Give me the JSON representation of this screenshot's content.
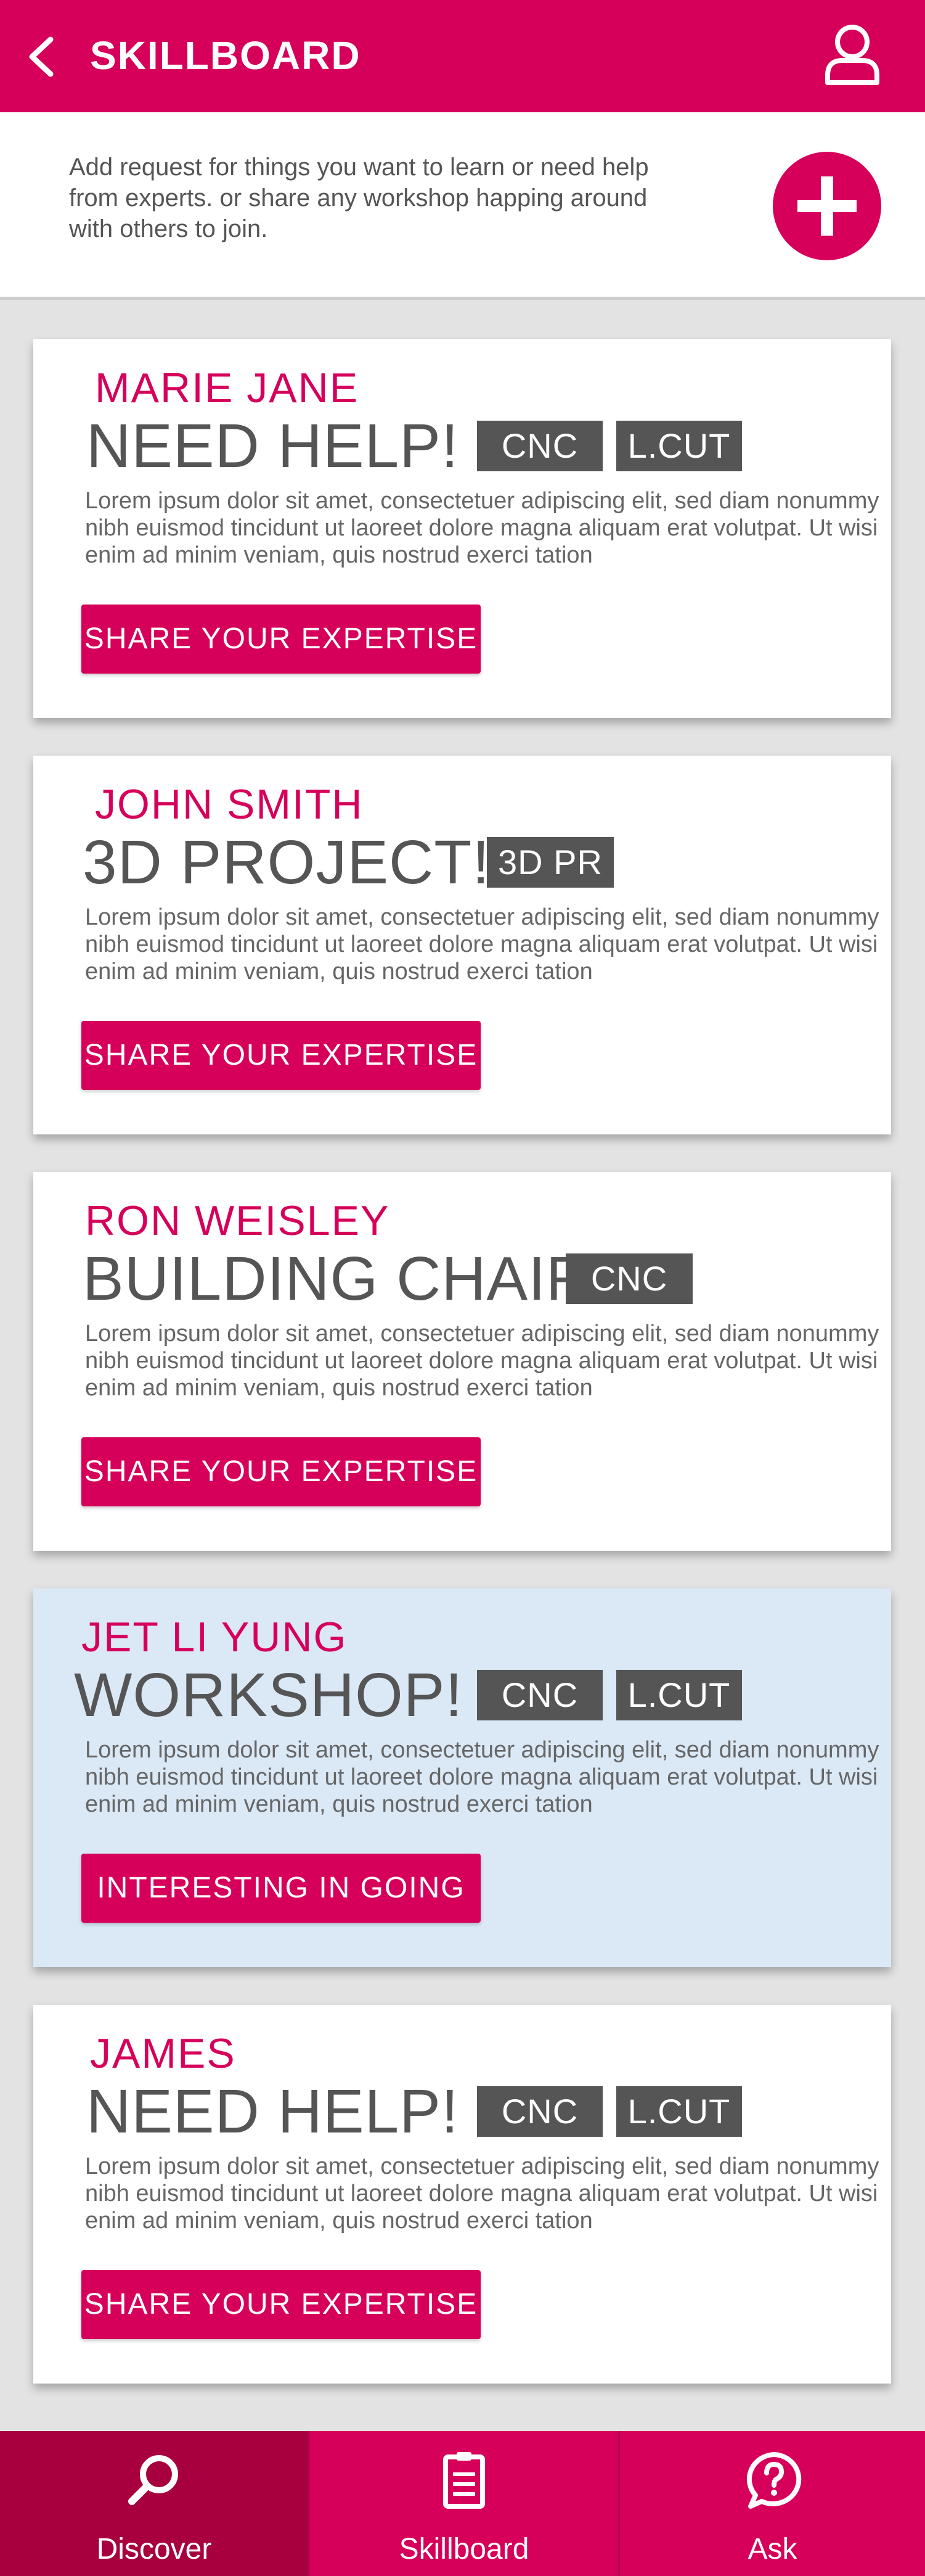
{
  "header": {
    "title": "SKILLBOARD",
    "back_icon": "chevron-left-icon",
    "profile_icon": "user-icon"
  },
  "intro": {
    "text": "Add request for things you want to learn  or need help from experts. or share any workshop happing around with others to join.",
    "add_icon": "plus-icon"
  },
  "cards": [
    {
      "name": "MARIE JANE",
      "title": "NEED HELP!",
      "tags": [
        "CNC",
        "L.CUT"
      ],
      "body": "Lorem ipsum dolor sit amet, consectetuer adipiscing elit, sed diam nonummy nibh euismod tincidunt ut laoreet dolore magna aliquam erat volutpat. Ut wisi enim ad minim veniam, quis nostrud exerci tation",
      "button": "SHARE YOUR EXPERTISE"
    },
    {
      "name": "JOHN SMITH",
      "title": "3D PROJECT!",
      "tags": [
        "3D PR"
      ],
      "body": "Lorem ipsum dolor sit amet, consectetuer adipiscing elit, sed diam nonummy nibh euismod tincidunt ut laoreet dolore magna aliquam erat volutpat. Ut wisi enim ad minim veniam, quis nostrud exerci tation",
      "button": "SHARE YOUR EXPERTISE"
    },
    {
      "name": "RON WEISLEY",
      "title": "BUILDING CHAIR",
      "tags": [
        "CNC"
      ],
      "body": "Lorem ipsum dolor sit amet, consectetuer adipiscing elit, sed diam nonummy nibh euismod tincidunt ut laoreet dolore magna aliquam erat volutpat. Ut wisi enim ad minim veniam, quis nostrud exerci tation",
      "button": "SHARE YOUR EXPERTISE"
    },
    {
      "name": "JET LI YUNG",
      "title": "WORKSHOP!",
      "tags": [
        "CNC",
        "L.CUT"
      ],
      "body": "Lorem ipsum dolor sit amet, consectetuer adipiscing elit, sed diam nonummy nibh euismod tincidunt ut laoreet dolore magna aliquam erat volutpat. Ut wisi enim ad minim veniam, quis nostrud exerci tation",
      "button": "INTERESTING IN GOING"
    },
    {
      "name": "JAMES",
      "title": "NEED HELP!",
      "tags": [
        "CNC",
        "L.CUT"
      ],
      "body": "Lorem ipsum dolor sit amet, consectetuer adipiscing elit, sed diam nonummy nibh euismod tincidunt ut laoreet dolore magna aliquam erat volutpat. Ut wisi enim ad minim veniam, quis nostrud exerci tation",
      "button": "SHARE YOUR EXPERTISE"
    }
  ],
  "bottom_nav": [
    {
      "label": "Discover",
      "icon": "search-icon",
      "active": true
    },
    {
      "label": "Skillboard",
      "icon": "clipboard-icon",
      "active": false
    },
    {
      "label": "Ask",
      "icon": "question-bubble-icon",
      "active": false
    }
  ],
  "colors": {
    "brand": "#d6005a",
    "brand_dark": "#a8003f",
    "tag": "#555555",
    "highlight_card": "#dbe8f6"
  }
}
